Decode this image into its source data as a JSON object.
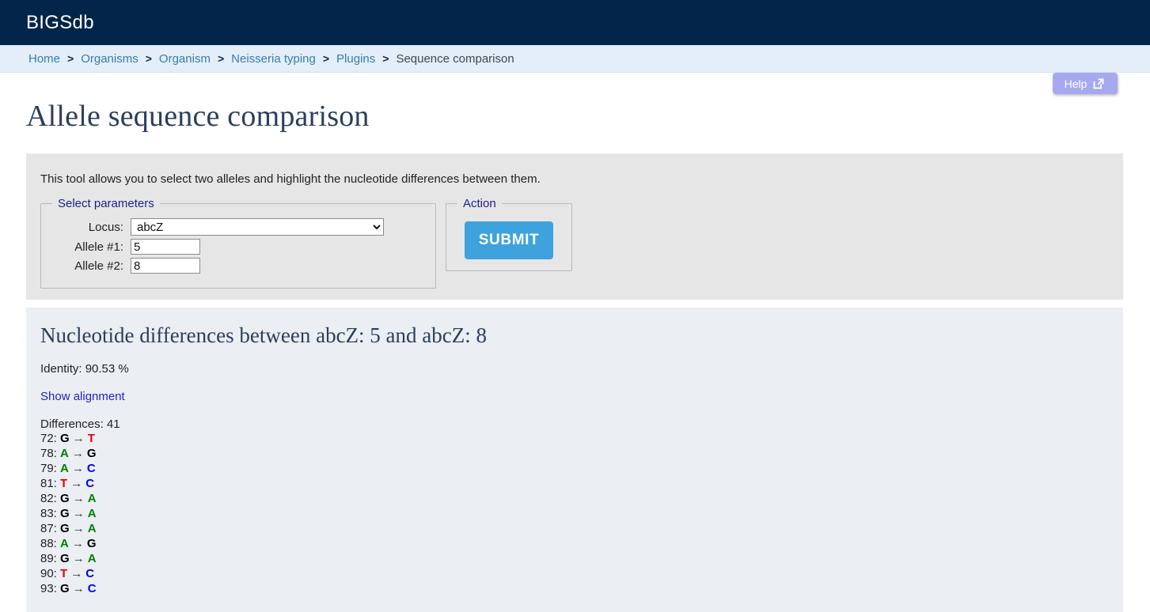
{
  "header": {
    "site_title": "BIGSdb"
  },
  "breadcrumb": {
    "separator": ">",
    "items": [
      {
        "label": "Home",
        "current": false
      },
      {
        "label": "Organisms",
        "current": false
      },
      {
        "label": "Organism",
        "current": false
      },
      {
        "label": "Neisseria typing",
        "current": false
      },
      {
        "label": "Plugins",
        "current": false
      },
      {
        "label": "Sequence comparison",
        "current": true
      }
    ]
  },
  "help_button": {
    "label": "Help",
    "icon": "external-link-icon"
  },
  "page": {
    "title": "Allele sequence comparison"
  },
  "form_panel": {
    "intro": "This tool allows you to select two alleles and highlight the nucleotide differences between them.",
    "params_legend": "Select parameters",
    "action_legend": "Action",
    "locus_label": "Locus:",
    "locus_value": "abcZ",
    "locus_options": [
      "abcZ"
    ],
    "allele1_label": "Allele #1:",
    "allele1_value": "5",
    "allele2_label": "Allele #2:",
    "allele2_value": "8",
    "submit_label": "SUBMIT"
  },
  "results": {
    "heading": "Nucleotide differences between abcZ: 5 and abcZ: 8",
    "identity": "Identity: 90.53 %",
    "show_alignment_label": "Show alignment",
    "differences_label": "Differences: 41",
    "arrow": "→",
    "differences": [
      {
        "position": "72",
        "from": "G",
        "to": "T"
      },
      {
        "position": "78",
        "from": "A",
        "to": "G"
      },
      {
        "position": "79",
        "from": "A",
        "to": "C"
      },
      {
        "position": "81",
        "from": "T",
        "to": "C"
      },
      {
        "position": "82",
        "from": "G",
        "to": "A"
      },
      {
        "position": "83",
        "from": "G",
        "to": "A"
      },
      {
        "position": "87",
        "from": "G",
        "to": "A"
      },
      {
        "position": "88",
        "from": "A",
        "to": "G"
      },
      {
        "position": "89",
        "from": "G",
        "to": "A"
      },
      {
        "position": "90",
        "from": "T",
        "to": "C"
      },
      {
        "position": "93",
        "from": "G",
        "to": "C"
      }
    ]
  },
  "colors": {
    "header_bg": "#04254a",
    "breadcrumb_bg": "#e3eef8",
    "breadcrumb_link": "#3a7ca8",
    "title_text": "#2b3f5c",
    "form_panel_bg": "#e6e6e6",
    "results_panel_bg": "#ebeef3",
    "submit_bg": "#3ea2dd",
    "help_bg": "#a6a9ef",
    "legend_text": "#1b1f8c",
    "link": "#2222cc",
    "base_A": "#008000",
    "base_C": "#0000ee",
    "base_G": "#000000",
    "base_T": "#e60000"
  }
}
